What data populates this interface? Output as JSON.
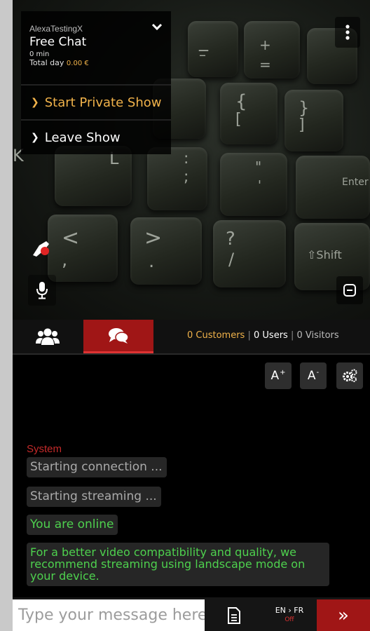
{
  "info_panel": {
    "username": "AlexaTestingX",
    "chat_mode": "Free Chat",
    "duration": "0 min",
    "total_label": "Total day ",
    "total_amount": "0.00 €",
    "private_show_label": "Start Private Show",
    "leave_show_label": "Leave Show"
  },
  "tabs": {
    "users_icon": "users-icon",
    "chat_icon": "chat-bubbles-icon"
  },
  "counts": {
    "customers": "0 Customers",
    "users": "0 Users",
    "visitors": "0 Visitors",
    "separator": "|"
  },
  "toolbar": {
    "font_up_label": "A",
    "font_up_sup": "+",
    "font_down_label": "A",
    "font_down_sup": "-",
    "settings_icon": "gears-icon"
  },
  "chat": {
    "sender": "System",
    "messages": [
      "Starting connection ...",
      "Starting streaming ...",
      "You are online",
      "For a better video compatibility and quality, we recommend streaming using landscape mode on your device."
    ]
  },
  "input": {
    "placeholder": "Type your message here",
    "translate_pair": "EN › FR",
    "translate_state": "Off",
    "send_label": "»"
  },
  "colors": {
    "accent_red": "#a01616",
    "accent_orange": "#f0b24a",
    "online_green": "#4ed14e"
  }
}
